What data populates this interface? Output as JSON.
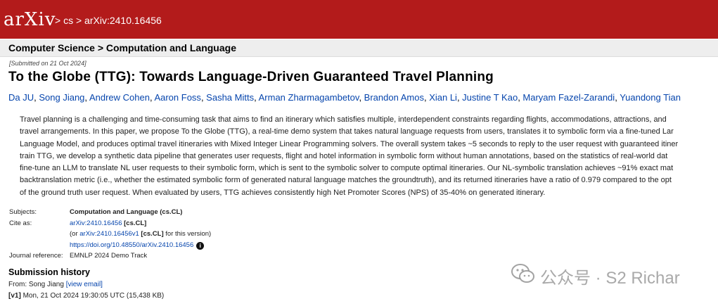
{
  "topbar": {
    "logo": "arXiv",
    "breadcrumb": [
      ">",
      "cs",
      ">",
      "arXiv:2410.16456"
    ]
  },
  "subheader": "Computer Science > Computation and Language",
  "submitted": "[Submitted on 21 Oct 2024]",
  "title": "To the Globe (TTG): Towards Language-Driven Guaranteed Travel Planning",
  "authors": [
    "Da JU",
    "Song Jiang",
    "Andrew Cohen",
    "Aaron Foss",
    "Sasha Mitts",
    "Arman Zharmagambetov",
    "Brandon Amos",
    "Xian Li",
    "Justine T Kao",
    "Maryam Fazel-Zarandi",
    "Yuandong Tian"
  ],
  "abstract_lines": [
    "Travel planning is a challenging and time-consuming task that aims to find an itinerary which satisfies multiple, interdependent constraints regarding flights, accommodations, attractions, and",
    "travel arrangements. In this paper, we propose To the Globe (TTG), a real-time demo system that takes natural language requests from users, translates it to symbolic form via a fine-tuned Lar",
    "Language Model, and produces optimal travel itineraries with Mixed Integer Linear Programming solvers. The overall system takes ~5 seconds to reply to the user request with guaranteed itiner",
    "train TTG, we develop a synthetic data pipeline that generates user requests, flight and hotel information in symbolic form without human annotations, based on the statistics of real-world dat",
    "fine-tune an LLM to translate NL user requests to their symbolic form, which is sent to the symbolic solver to compute optimal itineraries. Our NL-symbolic translation achieves ~91% exact mat",
    "backtranslation metric (i.e., whether the estimated symbolic form of generated natural language matches the groundtruth), and its returned itineraries have a ratio of 0.979 compared to the opt",
    "of the ground truth user request. When evaluated by users, TTG achieves consistently high Net Promoter Scores (NPS) of 35-40% on generated itinerary."
  ],
  "meta": {
    "subjects_label": "Subjects:",
    "subjects_value": "Computation and Language (cs.CL)",
    "cite_label": "Cite as:",
    "cite_link": "arXiv:2410.16456",
    "cite_tag": "[cs.CL]",
    "cite_v_prefix": "(or",
    "cite_v_link": "arXiv:2410.16456v1",
    "cite_v_tag": "[cs.CL]",
    "cite_v_suffix": "for this version)",
    "doi": "https://doi.org/10.48550/arXiv.2410.16456",
    "journal_label": "Journal reference:",
    "journal_value": "EMNLP 2024 Demo Track"
  },
  "history": {
    "heading": "Submission history",
    "from_text": "From: Song Jiang",
    "view_email": "[view email]",
    "v1_label": "[v1]",
    "v1_text": "Mon, 21 Oct 2024 19:30:05 UTC (15,438 KB)"
  },
  "watermark": "公众号 · S2 Richar",
  "icons": {
    "info": "info-icon",
    "wechat": "wechat-icon"
  }
}
